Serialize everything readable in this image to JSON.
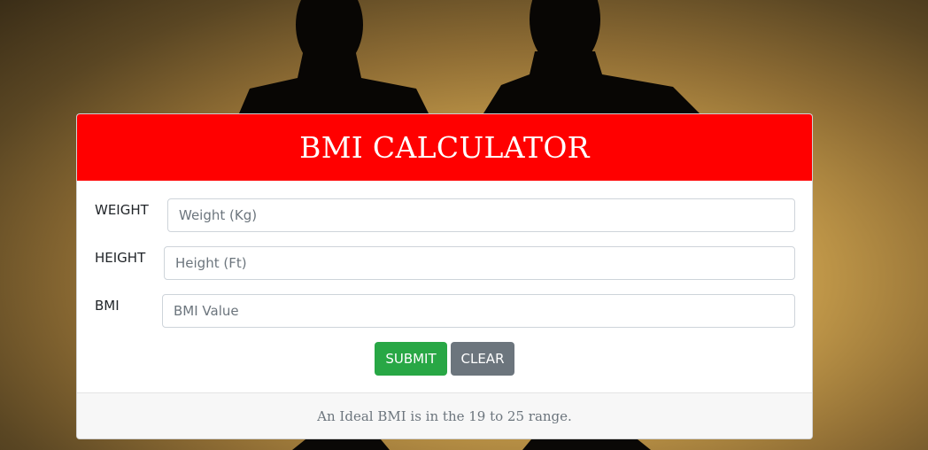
{
  "title": "BMI CALCULATOR",
  "form": {
    "weight": {
      "label": "WEIGHT",
      "placeholder": "Weight (Kg)",
      "value": ""
    },
    "height": {
      "label": "HEIGHT",
      "placeholder": "Height (Ft)",
      "value": ""
    },
    "bmi": {
      "label": "BMI",
      "placeholder": "BMI Value",
      "value": ""
    }
  },
  "buttons": {
    "submit": "SUBMIT",
    "clear": "CLEAR"
  },
  "footer": {
    "text": "An Ideal BMI is in the 19 to 25 range."
  },
  "colors": {
    "header": "#ff0000",
    "submit": "#28a745",
    "clear": "#6c757d",
    "footer_bg": "#f7f7f7"
  },
  "background": {
    "description_icon": "silhouette-figures-image"
  }
}
